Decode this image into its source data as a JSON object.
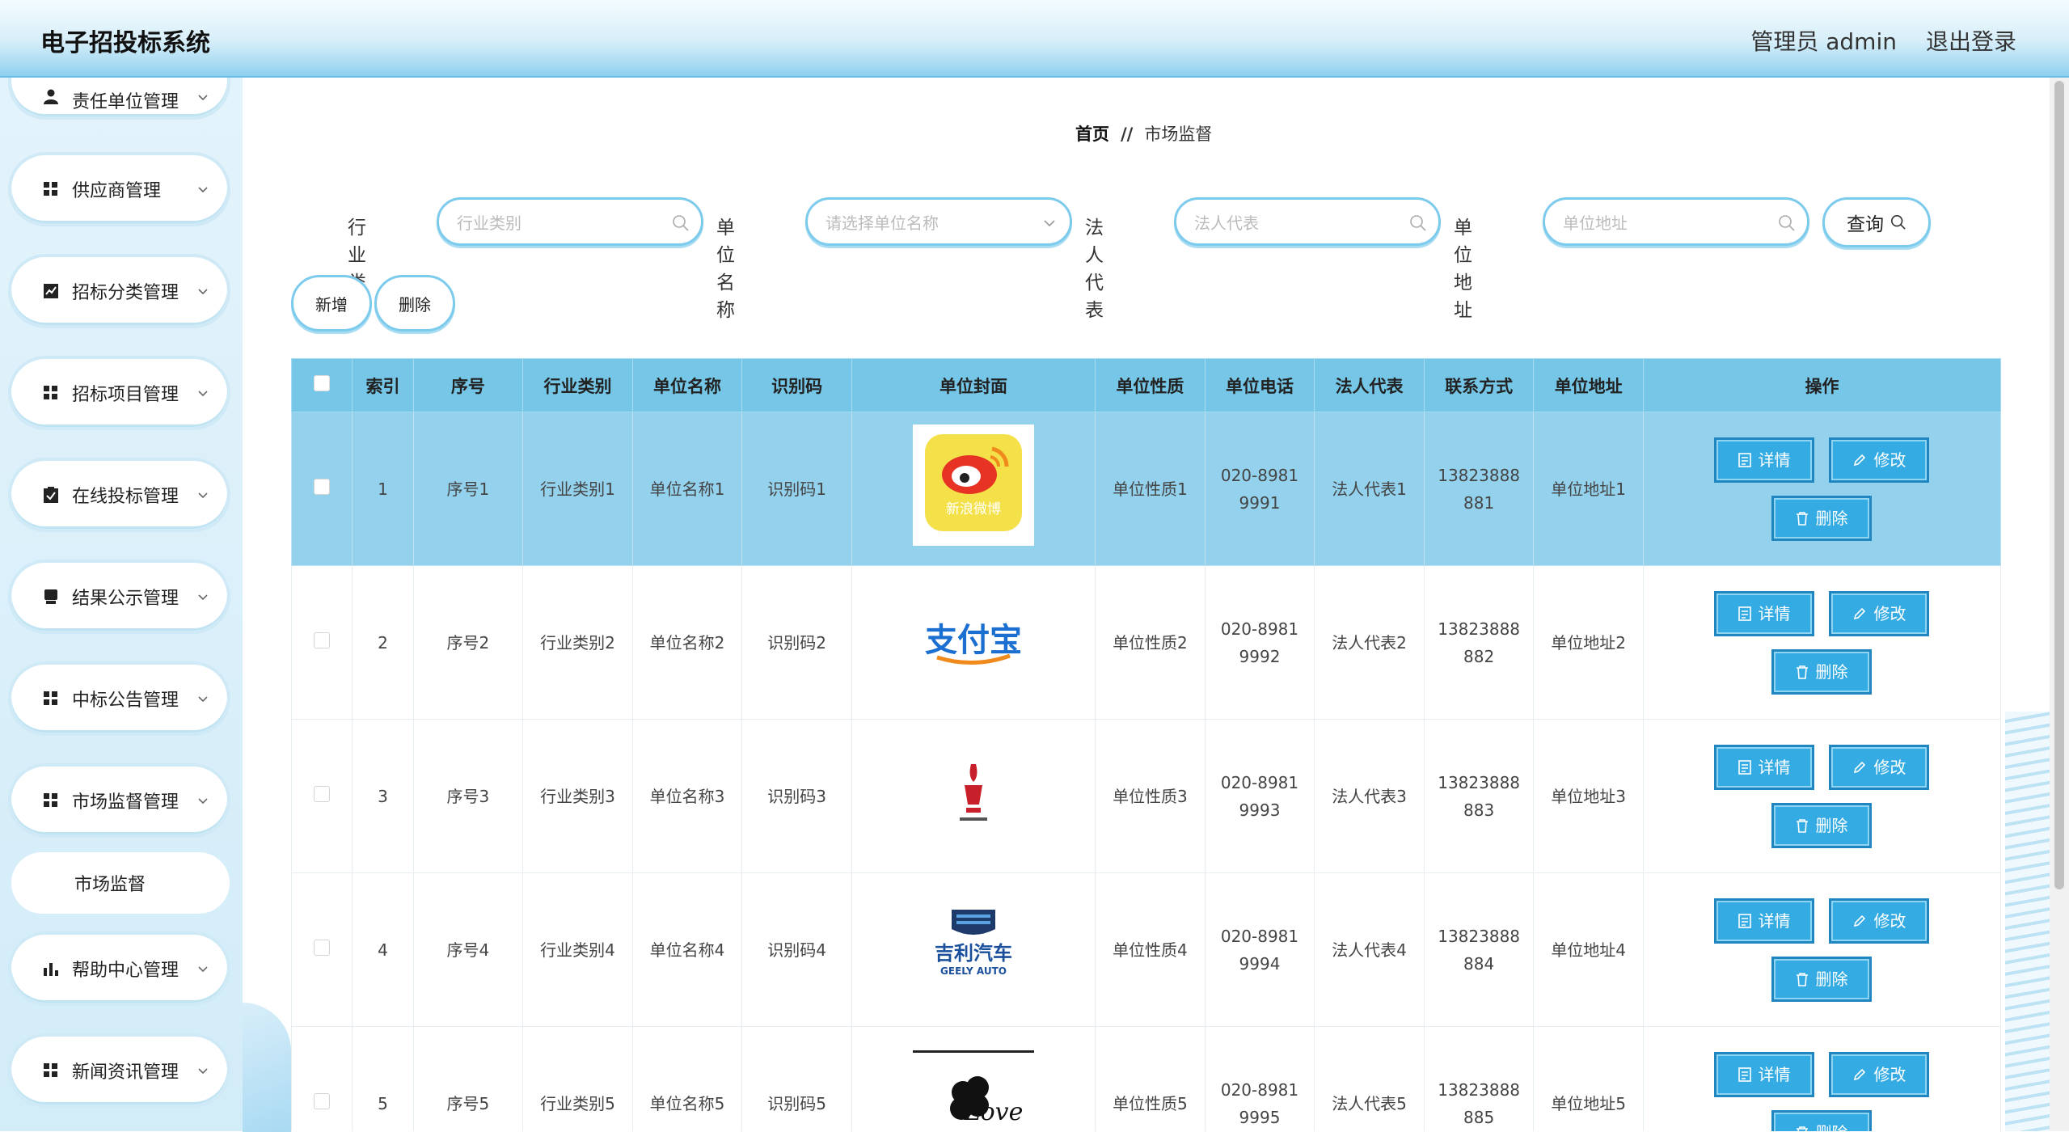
{
  "header": {
    "title": "电子招投标系统",
    "user": "管理员 admin",
    "logout": "退出登录"
  },
  "sidebar": {
    "items": [
      {
        "label": "责任单位管理",
        "icon": "user-icon"
      },
      {
        "label": "供应商管理",
        "icon": "grid-icon"
      },
      {
        "label": "招标分类管理",
        "icon": "chart-icon"
      },
      {
        "label": "招标项目管理",
        "icon": "grid-icon"
      },
      {
        "label": "在线投标管理",
        "icon": "clipboard-icon"
      },
      {
        "label": "结果公示管理",
        "icon": "document-icon"
      },
      {
        "label": "中标公告管理",
        "icon": "grid-icon"
      },
      {
        "label": "市场监督管理",
        "icon": "grid-icon"
      },
      {
        "label": "帮助中心管理",
        "icon": "bar-chart-icon"
      },
      {
        "label": "新闻资讯管理",
        "icon": "grid-icon"
      }
    ],
    "sub_item": "市场监督"
  },
  "breadcrumb": {
    "home": "首页",
    "sep": "//",
    "current": "市场监督"
  },
  "search": {
    "fields": [
      {
        "label": "行业类别",
        "placeholder": "行业类别"
      },
      {
        "label": "单位名称",
        "placeholder": "请选择单位名称"
      },
      {
        "label": "法人代表",
        "placeholder": "法人代表"
      },
      {
        "label": "单位地址",
        "placeholder": "单位地址"
      }
    ],
    "button": "查询"
  },
  "actions": {
    "add": "新增",
    "delete": "删除"
  },
  "table": {
    "headers": [
      "索引",
      "序号",
      "行业类别",
      "单位名称",
      "识别码",
      "单位封面",
      "单位性质",
      "单位电话",
      "法人代表",
      "联系方式",
      "单位地址",
      "操作"
    ],
    "rows": [
      {
        "index": "1",
        "seq": "序号1",
        "industry": "行业类别1",
        "name": "单位名称1",
        "code": "识别码1",
        "logo": "weibo-logo",
        "nature": "单位性质1",
        "phone": "020-8981 9991",
        "legal": "法人代表1",
        "contact": "13823888 881",
        "address": "单位地址1"
      },
      {
        "index": "2",
        "seq": "序号2",
        "industry": "行业类别2",
        "name": "单位名称2",
        "code": "识别码2",
        "logo": "alipay-logo",
        "nature": "单位性质2",
        "phone": "020-8981 9992",
        "legal": "法人代表2",
        "contact": "13823888 882",
        "address": "单位地址2"
      },
      {
        "index": "3",
        "seq": "序号3",
        "industry": "行业类别3",
        "name": "单位名称3",
        "code": "识别码3",
        "logo": "liquor-logo",
        "nature": "单位性质3",
        "phone": "020-8981 9993",
        "legal": "法人代表3",
        "contact": "13823888 883",
        "address": "单位地址3"
      },
      {
        "index": "4",
        "seq": "序号4",
        "industry": "行业类别4",
        "name": "单位名称4",
        "code": "识别码4",
        "logo": "geely-logo",
        "nature": "单位性质4",
        "phone": "020-8981 9994",
        "legal": "法人代表4",
        "contact": "13823888 884",
        "address": "单位地址4"
      },
      {
        "index": "5",
        "seq": "序号5",
        "industry": "行业类别5",
        "name": "单位名称5",
        "code": "识别码5",
        "logo": "clover-logo",
        "nature": "单位性质5",
        "phone": "020-8981 9995",
        "legal": "法人代表5",
        "contact": "13823888 885",
        "address": "单位地址5"
      }
    ],
    "ops": {
      "detail": "详情",
      "edit": "修改",
      "delete": "删除"
    },
    "logo_text": {
      "weibo": "新浪微博",
      "alipay": "支付宝",
      "geely_cn": "吉利汽车",
      "geely_en": "GEELY AUTO",
      "clover": "Love"
    }
  },
  "colors": {
    "accent": "#34abe2",
    "header_row": "#75c6e7",
    "selected_row": "#93d1ec",
    "border": "#7ccbec"
  }
}
